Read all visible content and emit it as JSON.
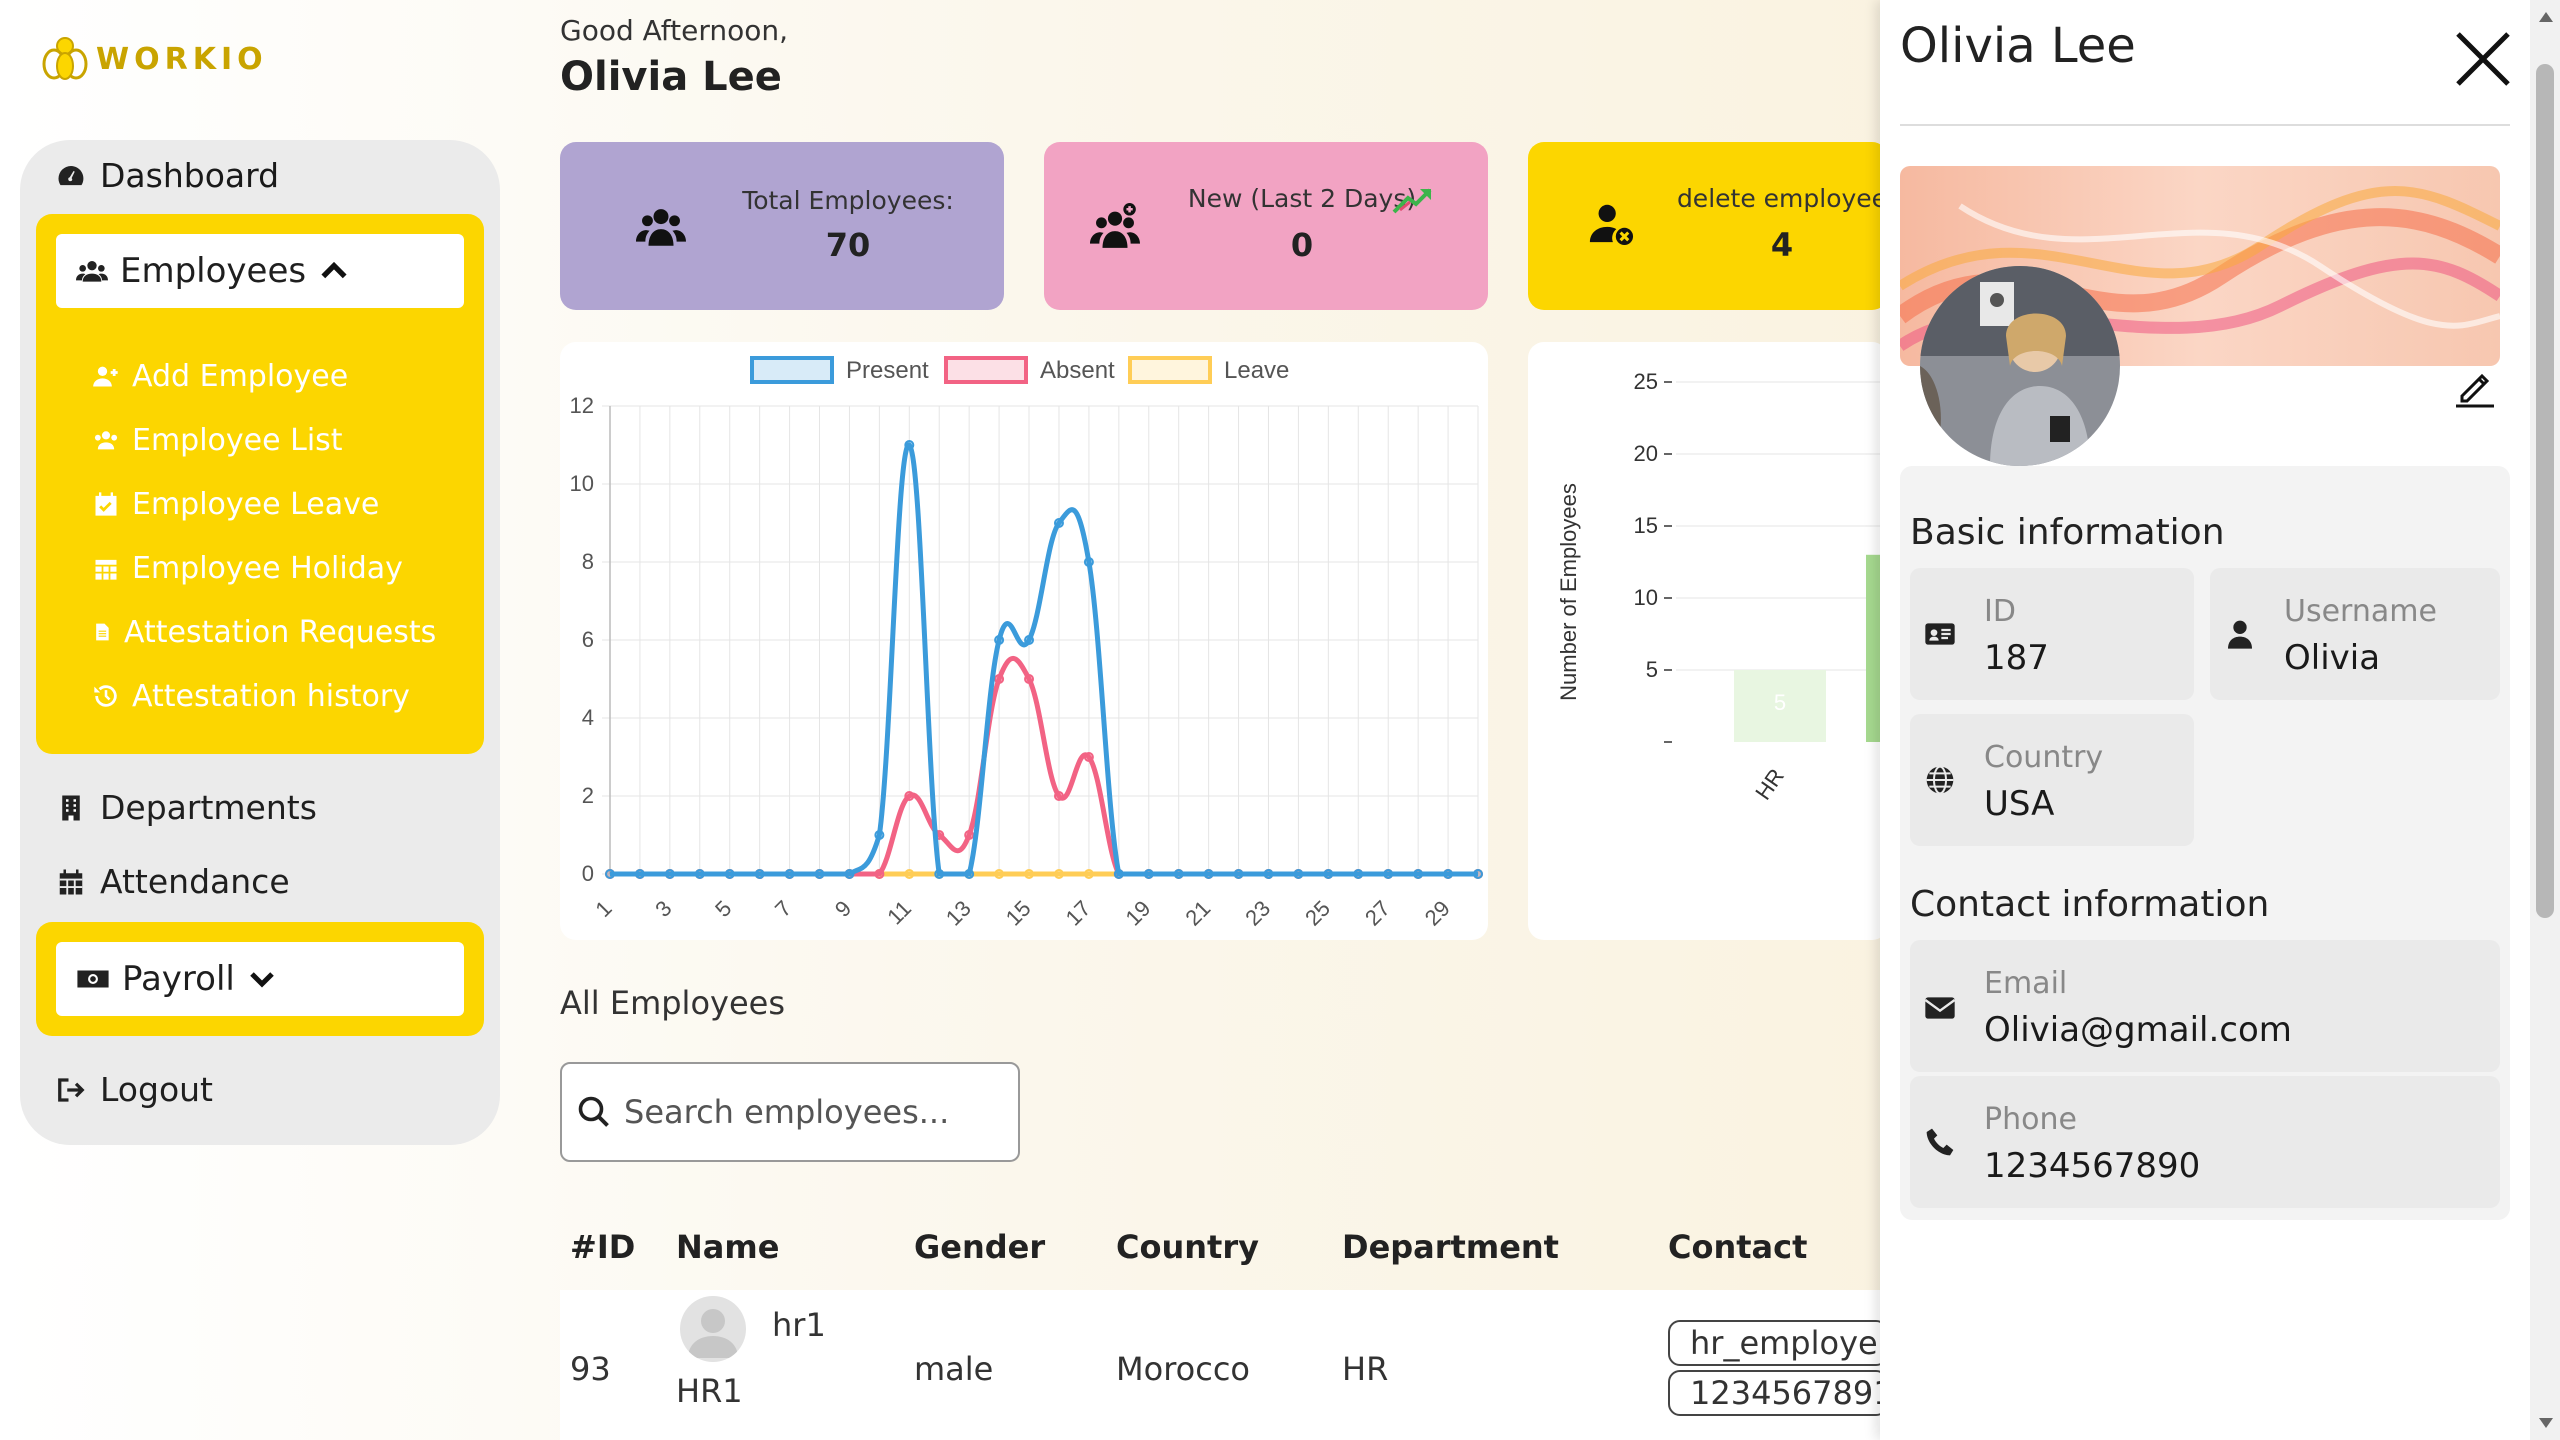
{
  "brand": {
    "name": "WORKIO"
  },
  "sidebar": {
    "dashboard": "Dashboard",
    "employees": "Employees",
    "sub_items": [
      {
        "label": "Add Employee",
        "icon": "user-plus-icon"
      },
      {
        "label": "Employee List",
        "icon": "users-icon"
      },
      {
        "label": "Employee Leave",
        "icon": "calendar-check-icon"
      },
      {
        "label": "Employee Holiday",
        "icon": "calendar-icon"
      },
      {
        "label": "Attestation Requests",
        "icon": "file-icon"
      },
      {
        "label": "Attestation history",
        "icon": "history-icon"
      }
    ],
    "departments": "Departments",
    "attendance": "Attendance",
    "payroll": "Payroll",
    "logout": "Logout"
  },
  "header": {
    "greeting": "Good Afternoon,",
    "user_name": "Olivia Lee"
  },
  "stats": [
    {
      "label": "Total Employees:",
      "value": "70",
      "color": "#b0a4d1",
      "icon": "users-icon"
    },
    {
      "label": "New (Last 2 Days)",
      "value": "0",
      "color": "#f2a3c3",
      "icon": "users-plus-icon"
    },
    {
      "label": "delete employee",
      "value": "4",
      "color": "#fcd600",
      "icon": "user-delete-icon"
    }
  ],
  "chart_data": [
    {
      "type": "line",
      "legend": [
        "Present",
        "Absent",
        "Leave"
      ],
      "x": [
        1,
        2,
        3,
        4,
        5,
        6,
        7,
        8,
        9,
        10,
        11,
        12,
        13,
        14,
        15,
        16,
        17,
        18,
        19,
        20,
        21,
        22,
        23,
        24,
        25,
        26,
        27,
        28,
        29,
        30
      ],
      "xticks": [
        "1",
        "3",
        "5",
        "7",
        "9",
        "11",
        "13",
        "15",
        "17",
        "19",
        "21",
        "23",
        "25",
        "27",
        "29"
      ],
      "ylim": [
        0,
        12
      ],
      "yticks": [
        "0",
        "2",
        "4",
        "6",
        "8",
        "10",
        "12"
      ],
      "series": [
        {
          "name": "Present",
          "color": "#3b9bdb",
          "values": [
            0,
            0,
            0,
            0,
            0,
            0,
            0,
            0,
            0,
            1,
            11,
            0,
            0,
            6,
            6,
            9,
            8,
            0,
            0,
            0,
            0,
            0,
            0,
            0,
            0,
            0,
            0,
            0,
            0,
            0
          ]
        },
        {
          "name": "Absent",
          "color": "#f26384",
          "values": [
            0,
            0,
            0,
            0,
            0,
            0,
            0,
            0,
            0,
            0,
            2,
            1,
            1,
            5,
            5,
            2,
            3,
            0,
            0,
            0,
            0,
            0,
            0,
            0,
            0,
            0,
            0,
            0,
            0,
            0
          ]
        },
        {
          "name": "Leave",
          "color": "#ffcd56",
          "values": [
            0,
            0,
            0,
            0,
            0,
            0,
            0,
            0,
            0,
            0,
            0,
            0,
            0,
            0,
            0,
            0,
            0,
            0,
            0,
            0,
            0,
            0,
            0,
            0,
            0,
            0,
            0,
            0,
            0,
            0
          ]
        }
      ]
    },
    {
      "type": "bar",
      "ylabel": "Number of Employees",
      "ylim": [
        0,
        25
      ],
      "yticks": [
        "5",
        "10",
        "15",
        "20",
        "25"
      ],
      "categories": [
        "HR"
      ],
      "values": [
        5
      ],
      "bar_label": "5",
      "partial_next_value": 13
    }
  ],
  "table": {
    "section_title": "All Employees",
    "search_placeholder": "Search employees...",
    "columns": [
      "#ID",
      "Name",
      "Gender",
      "Country",
      "Department",
      "Contact"
    ],
    "rows": [
      {
        "id": "93",
        "username": "hr1",
        "name": "HR1",
        "gender": "male",
        "country": "Morocco",
        "department": "HR",
        "contact_email": "hr_employe",
        "contact_phone": "1234567891"
      }
    ]
  },
  "profile": {
    "name": "Olivia Lee",
    "basic_title": "Basic information",
    "id_label": "ID",
    "id_value": "187",
    "username_label": "Username",
    "username_value": "Olivia",
    "country_label": "Country",
    "country_value": "USA",
    "contact_title": "Contact information",
    "email_label": "Email",
    "email_value": "Olivia@gmail.com",
    "phone_label": "Phone",
    "phone_value": "1234567890"
  }
}
